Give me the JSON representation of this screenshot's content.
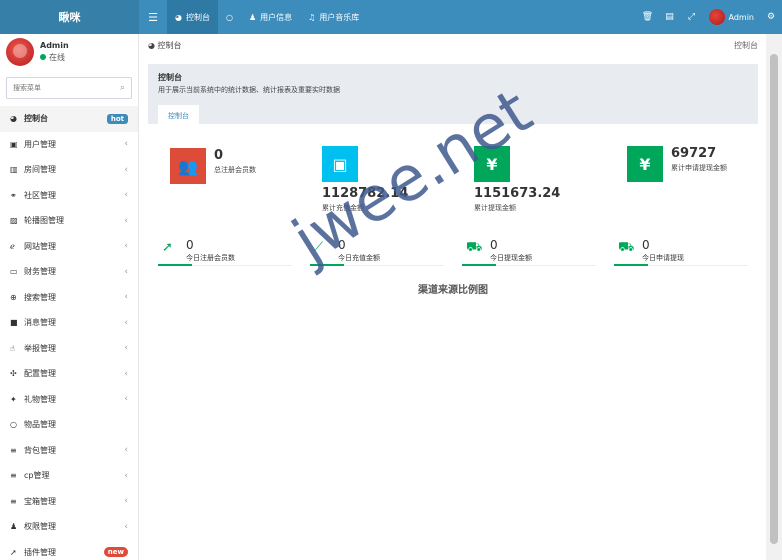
{
  "header": {
    "logo": "瞅咪",
    "nav": [
      {
        "icon": "dashboard-icon",
        "label": "控制台",
        "active": true
      },
      {
        "icon": "circle-icon",
        "label": ""
      },
      {
        "icon": "user-icon",
        "label": "用户信息"
      },
      {
        "icon": "music-icon",
        "label": "用户音乐库"
      }
    ],
    "user": "Admin"
  },
  "sidebar": {
    "user": {
      "name": "Admin",
      "status": "在线"
    },
    "search_placeholder": "搜索菜单",
    "items": [
      {
        "label": "控制台",
        "badge": "hot"
      },
      {
        "label": "用户管理"
      },
      {
        "label": "房间管理"
      },
      {
        "label": "社区管理"
      },
      {
        "label": "轮播图管理"
      },
      {
        "label": "网站管理"
      },
      {
        "label": "财务管理"
      },
      {
        "label": "搜索管理"
      },
      {
        "label": "消息管理"
      },
      {
        "label": "举报管理"
      },
      {
        "label": "配置管理"
      },
      {
        "label": "礼物管理"
      },
      {
        "label": "物品管理"
      },
      {
        "label": "背包管理"
      },
      {
        "label": "cp管理"
      },
      {
        "label": "宝箱管理"
      },
      {
        "label": "权限管理"
      },
      {
        "label": "插件管理",
        "badge": "new"
      }
    ]
  },
  "main": {
    "breadcrumb": "控制台",
    "breadcrumb_right": "控制台",
    "panel_title": "控制台",
    "panel_desc": "用于展示当前系统中的统计数据、统计报表及重要实时数据",
    "tab": "控制台",
    "stats": [
      {
        "value": "0",
        "label": "总注册会员数",
        "color": "#dd4b39",
        "icon": "users-icon"
      },
      {
        "value": "1128782.14",
        "label": "累计充值金额",
        "color": "#00c0ef",
        "icon": "shopping-bag-icon"
      },
      {
        "value": "1151673.24",
        "label": "累计提现金额",
        "color": "#00a65a",
        "icon": "yen-icon"
      },
      {
        "value": "69727",
        "label": "累计申请提现金额",
        "color": "#00a65a",
        "icon": "yen-icon"
      }
    ],
    "today": [
      {
        "value": "0",
        "label": "今日注册会员数",
        "icon": "rocket-icon"
      },
      {
        "value": "0",
        "label": "今日充值金额",
        "icon": "line-chart-icon"
      },
      {
        "value": "0",
        "label": "今日提现金额",
        "icon": "cart-icon"
      },
      {
        "value": "0",
        "label": "今日申请提现",
        "icon": "cart-icon"
      }
    ],
    "chart_title": "渠道来源比例图"
  },
  "watermark": "jwee.net"
}
